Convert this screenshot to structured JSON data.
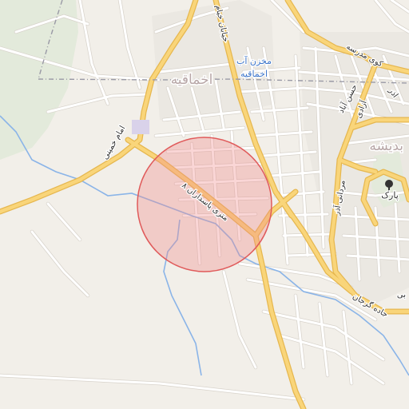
{
  "map": {
    "colors": {
      "background": "#f2efe9",
      "park": "#e3eadb",
      "residential": "#e6e3dd",
      "minor_road": "#ffffff",
      "minor_road_casing": "#d8d3cb",
      "major_road": "#f9d57a",
      "major_road_casing": "#e6b74f",
      "water": "#8ab4e8",
      "boundary": "#9a9aa6",
      "highlight_fill": "#f08a8a",
      "highlight_stroke": "#e05a5a",
      "place_label": "#b8a7a7",
      "road_label": "#333333",
      "water_label": "#3b74c9"
    },
    "labels": {
      "district_north": "اخماقیه",
      "district_east": "بدیشه",
      "water_tank": "مخزن آب",
      "water_tank_sub": "اخماقیه",
      "park": "پارک",
      "road_imam_khomeini": "امام خمینی",
      "road_pasdaran": "۸ متری پاسداران",
      "road_khayyam": "خیابان خیام",
      "road_modarres": "کوی مدرسه",
      "road_hassan_abad": "حسن آباد",
      "road_azar": "اذر",
      "road_azadi": "آزادی",
      "road_mardani": "مردانی آذر",
      "road_gorjan": "جاده گرجان",
      "road_edge_east": "بی"
    },
    "icons": {
      "park": "tree-icon",
      "water_tank": "water-tank-icon"
    },
    "highlight": {
      "shape": "circle",
      "meaning": "selected-area"
    }
  }
}
